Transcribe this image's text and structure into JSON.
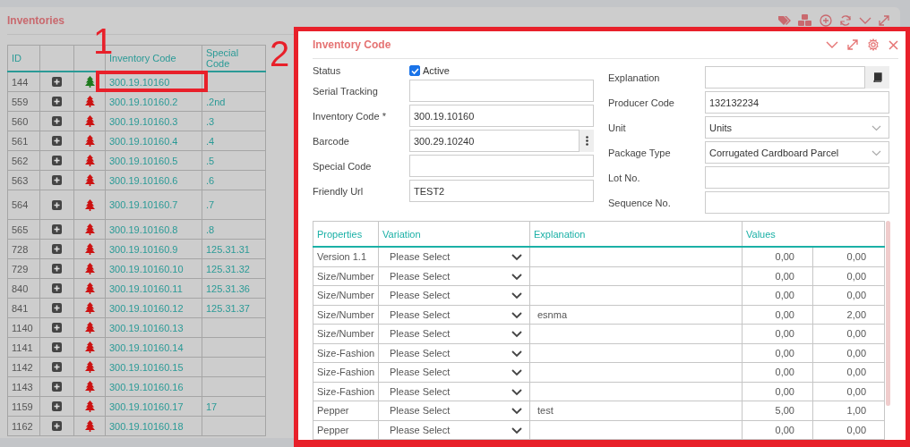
{
  "inventories": {
    "title": "Inventories",
    "columns": [
      "ID",
      "Inventory Code",
      "Special Code"
    ],
    "rows": [
      {
        "id": "144",
        "code": "300.19.10160",
        "special": "",
        "color": "#1e7a1e",
        "tall": false
      },
      {
        "id": "559",
        "code": "300.19.10160.2",
        "special": ".2nd",
        "color": "#cc1111",
        "tall": false
      },
      {
        "id": "560",
        "code": "300.19.10160.3",
        "special": ".3",
        "color": "#cc1111",
        "tall": false
      },
      {
        "id": "561",
        "code": "300.19.10160.4",
        "special": ".4",
        "color": "#cc1111",
        "tall": false
      },
      {
        "id": "562",
        "code": "300.19.10160.5",
        "special": ".5",
        "color": "#cc1111",
        "tall": false
      },
      {
        "id": "563",
        "code": "300.19.10160.6",
        "special": ".6",
        "color": "#cc1111",
        "tall": false
      },
      {
        "id": "564",
        "code": "300.19.10160.7",
        "special": ".7",
        "color": "#cc1111",
        "tall": true
      },
      {
        "id": "565",
        "code": "300.19.10160.8",
        "special": ".8",
        "color": "#cc1111",
        "tall": false
      },
      {
        "id": "728",
        "code": "300.19.10160.9",
        "special": "125.31.31",
        "color": "#cc1111",
        "tall": false
      },
      {
        "id": "729",
        "code": "300.19.10160.10",
        "special": "125.31.32",
        "color": "#cc1111",
        "tall": false
      },
      {
        "id": "840",
        "code": "300.19.10160.11",
        "special": "125.31.36",
        "color": "#cc1111",
        "tall": false
      },
      {
        "id": "841",
        "code": "300.19.10160.12",
        "special": "125.31.37",
        "color": "#cc1111",
        "tall": false
      },
      {
        "id": "1140",
        "code": "300.19.10160.13",
        "special": "",
        "color": "#cc1111",
        "tall": false
      },
      {
        "id": "1141",
        "code": "300.19.10160.14",
        "special": "",
        "color": "#cc1111",
        "tall": false
      },
      {
        "id": "1142",
        "code": "300.19.10160.15",
        "special": "",
        "color": "#cc1111",
        "tall": false
      },
      {
        "id": "1143",
        "code": "300.19.10160.16",
        "special": "",
        "color": "#cc1111",
        "tall": false
      },
      {
        "id": "1159",
        "code": "300.19.10160.17",
        "special": "17",
        "color": "#cc1111",
        "tall": false
      },
      {
        "id": "1162",
        "code": "300.19.10160.18",
        "special": "",
        "color": "#cc1111",
        "tall": false
      }
    ]
  },
  "annotations": [
    "1",
    "2"
  ],
  "dialog": {
    "title": "Inventory Code",
    "left": [
      {
        "label": "Status",
        "kind": "checkbox",
        "text": "Active",
        "checked": true
      },
      {
        "label": "Serial Tracking",
        "kind": "text"
      },
      {
        "label": "Inventory Code *",
        "kind": "text",
        "value": "300.19.10160"
      },
      {
        "label": "Barcode",
        "kind": "menu",
        "value": "300.29.10240"
      },
      {
        "label": "Special Code",
        "kind": "text"
      },
      {
        "label": "Friendly Url",
        "kind": "text",
        "value": "TEST2"
      }
    ],
    "right": [
      {
        "label": "Explanation",
        "kind": "book"
      },
      {
        "label": "Producer Code",
        "kind": "text",
        "value": "132132234"
      },
      {
        "label": "Unit",
        "kind": "select",
        "value": "Units"
      },
      {
        "label": "Package Type",
        "kind": "select",
        "value": "Corrugated Cardboard Parcel"
      },
      {
        "label": "Lot No.",
        "kind": "text"
      },
      {
        "label": "Sequence No.",
        "kind": "text"
      }
    ],
    "table": {
      "columns": [
        "Properties",
        "Variation",
        "Explanation",
        "Values"
      ],
      "rows": [
        {
          "property": "Version 1.1",
          "variation": "Please Select",
          "explanation": "",
          "value_1": "0,00",
          "value_2": "0,00"
        },
        {
          "property": "Size/Number",
          "variation": "Please Select",
          "explanation": "",
          "value_1": "0,00",
          "value_2": "0,00"
        },
        {
          "property": "Size/Number",
          "variation": "Please Select",
          "explanation": "",
          "value_1": "0,00",
          "value_2": "0,00"
        },
        {
          "property": "Size/Number",
          "variation": "Please Select",
          "explanation": "esnma",
          "value_1": "0,00",
          "value_2": "2,00"
        },
        {
          "property": "Size/Number",
          "variation": "Please Select",
          "explanation": "",
          "value_1": "0,00",
          "value_2": "0,00"
        },
        {
          "property": "Size-Fashion",
          "variation": "Please Select",
          "explanation": "",
          "value_1": "0,00",
          "value_2": "0,00"
        },
        {
          "property": "Size-Fashion",
          "variation": "Please Select",
          "explanation": "",
          "value_1": "0,00",
          "value_2": "0,00"
        },
        {
          "property": "Size-Fashion",
          "variation": "Please Select",
          "explanation": "",
          "value_1": "0,00",
          "value_2": "0,00"
        },
        {
          "property": "Pepper",
          "variation": "Please Select",
          "explanation": "test",
          "value_1": "5,00",
          "value_2": "1,00"
        },
        {
          "property": "Pepper",
          "variation": "Please Select",
          "explanation": "",
          "value_1": "0,00",
          "value_2": "0,00"
        }
      ]
    }
  }
}
